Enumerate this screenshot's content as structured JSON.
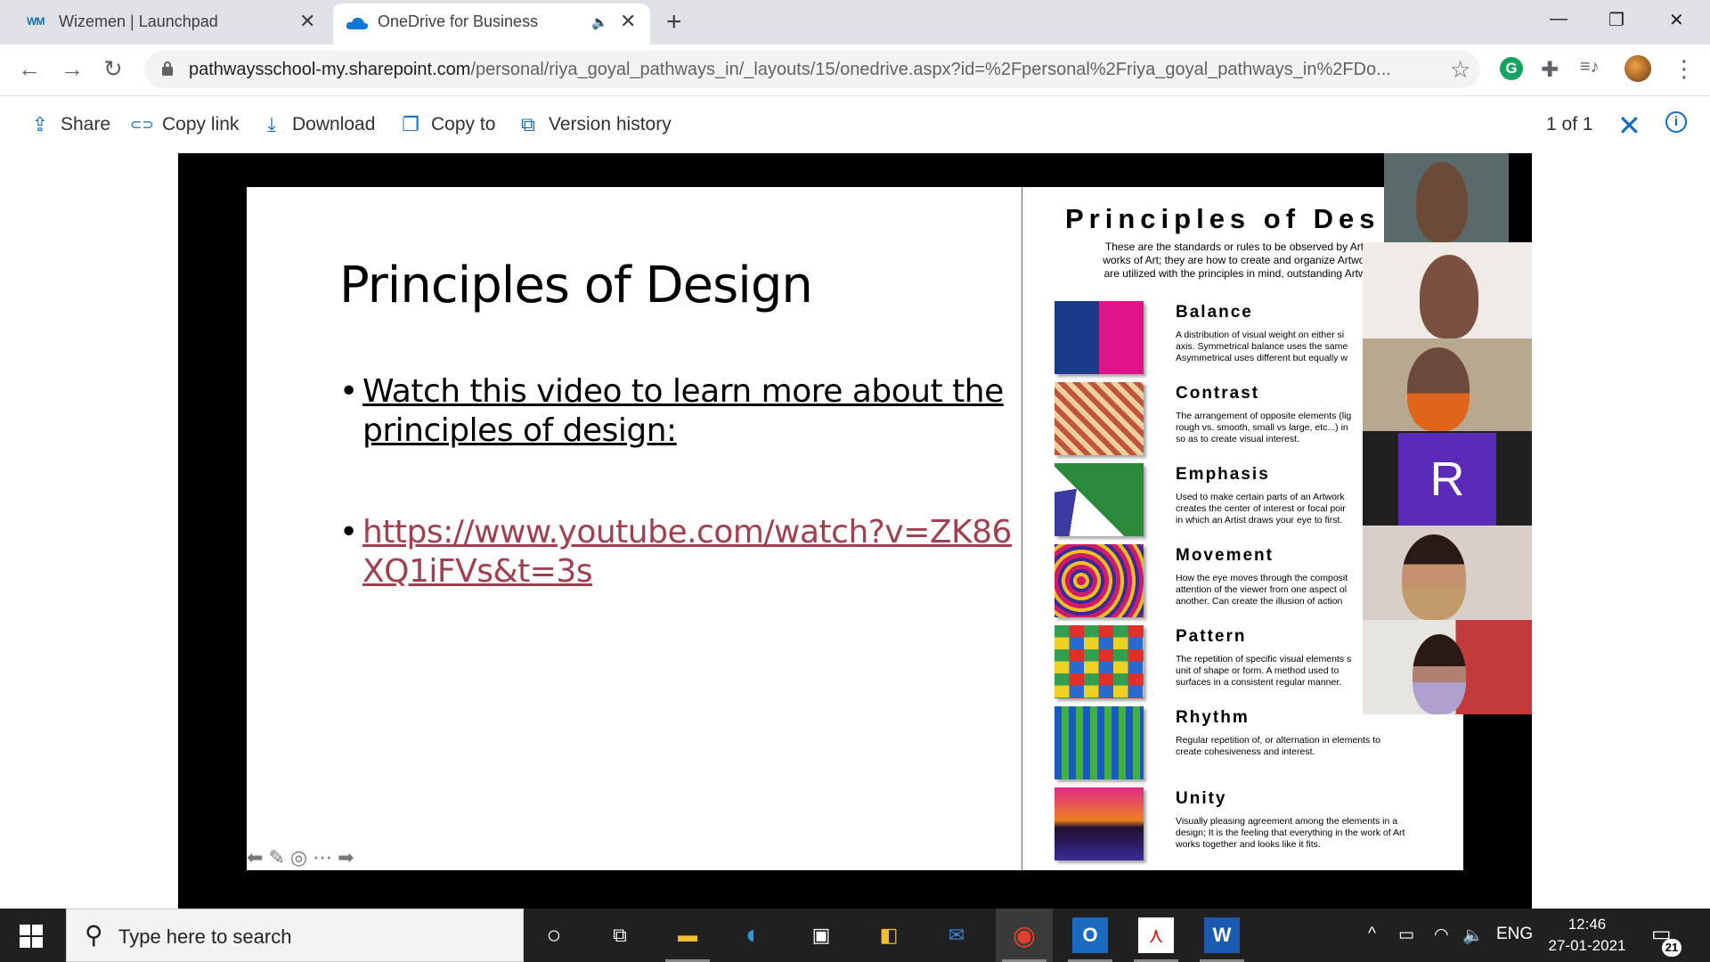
{
  "browser": {
    "tabs": [
      {
        "title": "Wizemen | Launchpad",
        "logo": "wizemen-logo",
        "logo_text": "WM"
      },
      {
        "title": "OneDrive for Business",
        "logo": "onedrive-logo",
        "audio_icon": "🔈",
        "active": true
      }
    ],
    "close_glyph": "✕",
    "new_tab_glyph": "+",
    "window_controls": {
      "minimize": "—",
      "restore": "❐",
      "close": "✕"
    },
    "nav": {
      "back": "←",
      "forward": "→",
      "reload": "↻",
      "menu": "⋮"
    },
    "url_domain": "pathwaysschool-my.sharepoint.com",
    "url_path": "/personal/riya_goyal_pathways_in/_layouts/15/onedrive.aspx?id=%2Fpersonal%2Friya_goyal_pathways_in%2FDo...",
    "star_glyph": "☆",
    "extension_g": "G",
    "extension_puzzle": "✚",
    "extension_media": "≡♪"
  },
  "toolbar": {
    "items": [
      {
        "label": "Share",
        "icon": "share-icon",
        "glyph": "⇪"
      },
      {
        "label": "Copy link",
        "icon": "link-icon",
        "glyph": "⊂⊃"
      },
      {
        "label": "Download",
        "icon": "download-icon",
        "glyph": "⤓"
      },
      {
        "label": "Copy to",
        "icon": "copy-icon",
        "glyph": "❐"
      },
      {
        "label": "Version history",
        "icon": "history-icon",
        "glyph": "⧉"
      }
    ],
    "page_count": "1 of 1",
    "close_glyph": "✕",
    "info_glyph": "i"
  },
  "slide": {
    "title": "Principles of Design",
    "bullet_dot": "•",
    "bullet_1": "Watch this video to learn more about the",
    "bullet_1b": "principles of design:",
    "bullet_2": "https://www.youtube.com/watch?v=ZK86",
    "bullet_2b": "XQ1iFVs&t=3s",
    "nav_glyphs": {
      "prev": "⬅",
      "pen": "✎",
      "home": "◎",
      "more": "⋯",
      "next": "➡"
    }
  },
  "poster": {
    "title": "Principles of Des",
    "intro_1": "These are the standards or rules to be observed by Artist",
    "intro_2": "works of Art; they are how to create and organize Artwork.",
    "intro_3": "are utilized with the principles in mind, outstanding Artwor",
    "items": [
      {
        "name": "Balance",
        "d1": "A distribution of visual weight on either si",
        "d2": "axis. Symmetrical balance uses the same",
        "d3": "Asymmetrical uses different but equally w"
      },
      {
        "name": "Contrast",
        "d1": "The arrangement of opposite elements (lig",
        "d2": "rough vs. smooth, small vs large, etc...) in",
        "d3": "so as to create visual interest."
      },
      {
        "name": "Emphasis",
        "d1": "Used to make certain parts of an Artwork",
        "d2": "creates the center of interest or focal poir",
        "d3": "in which an Artist draws your eye to first."
      },
      {
        "name": "Movement",
        "d1": "How the eye moves through the composit",
        "d2": "attention of the viewer from one aspect ol",
        "d3": "another. Can create the illusion of action"
      },
      {
        "name": "Pattern",
        "d1": "The repetition of specific visual elements s",
        "d2": "unit of shape or form. A method used to",
        "d3": "surfaces in a consistent regular manner."
      },
      {
        "name": "Rhythm",
        "d1": "Regular repetition of, or alternation in elements to",
        "d2": "create cohesiveness and interest.",
        "d3": ""
      },
      {
        "name": "Unity",
        "d1": "Visually pleasing agreement among the elements in a",
        "d2": "design; It is the feeling that everything in the work of Art",
        "d3": "works together and looks like it fits."
      }
    ]
  },
  "participants": {
    "avatar_initial": "R",
    "avatar_color": "#5b2ab8"
  },
  "taskbar": {
    "search_placeholder": "Type here to search",
    "search_glyph": "⚲",
    "cortana_glyph": "○",
    "taskview_glyph": "⧉",
    "apps": [
      {
        "name": "file-explorer",
        "glyph": "▬"
      },
      {
        "name": "edge",
        "glyph": "◐"
      },
      {
        "name": "store",
        "glyph": "▣"
      },
      {
        "name": "files",
        "glyph": "◧"
      },
      {
        "name": "mail",
        "glyph": "✉"
      },
      {
        "name": "chrome",
        "glyph": "◉"
      },
      {
        "name": "outlook",
        "glyph": "O"
      },
      {
        "name": "acrobat",
        "glyph": "⋏"
      },
      {
        "name": "word",
        "glyph": "W"
      }
    ],
    "tray_caret": "^",
    "tray_battery": "▭",
    "tray_wifi": "◠",
    "tray_volume": "🔈",
    "language": "ENG",
    "time": "12:46",
    "date": "27-01-2021",
    "notification_glyph": "▭",
    "notification_count": "21"
  }
}
